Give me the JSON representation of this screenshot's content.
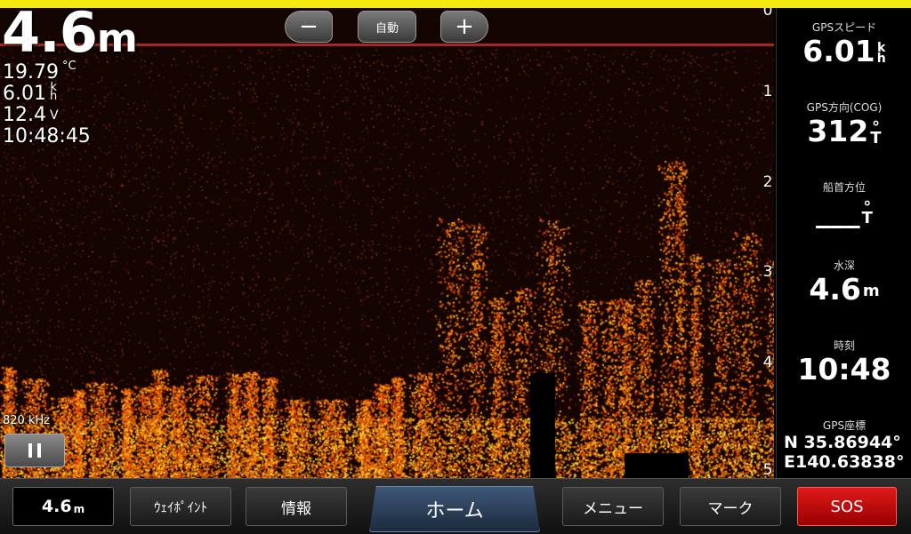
{
  "sonar": {
    "depth": "4.6",
    "depth_unit": "m",
    "water_temp": "19.79",
    "water_temp_unit": "°C",
    "speed": "6.01",
    "speed_unit_top": "k",
    "speed_unit_bottom": "h",
    "voltage": "12.4",
    "voltage_unit": "V",
    "time": "10:48:45",
    "frequency": "820 kHz",
    "zoom_minus": "−",
    "zoom_auto": "自動",
    "zoom_plus": "+",
    "depth_scale": [
      "0",
      "1",
      "2",
      "3",
      "4",
      "5"
    ]
  },
  "panel": {
    "gps_speed_label": "GPSスピード",
    "gps_speed_value": "6.01",
    "gps_speed_unit_top": "k",
    "gps_speed_unit_bottom": "h",
    "cog_label": "GPS方向(COG)",
    "cog_value": "312",
    "cog_unit_top": "°",
    "cog_unit_bottom": "T",
    "heading_label": "船首方位",
    "heading_value": "___",
    "heading_unit_top": "°",
    "heading_unit_bottom": "T",
    "depth_label": "水深",
    "depth_value": "4.6",
    "depth_unit": "m",
    "time_label": "時刻",
    "time_value": "10:48",
    "coord_label": "GPS座標",
    "lat": "N  35.86944°",
    "lon": "E140.63838°"
  },
  "bottom_bar": {
    "depth_value": "4.6",
    "depth_unit": "m",
    "waypoint": "ｳｪｲﾎﾟｲﾝﾄ",
    "info": "情報",
    "home": "ホーム",
    "menu": "メニュー",
    "mark": "マーク",
    "sos": "SOS"
  },
  "colors": {
    "sos": "#d00000",
    "home": "#2c4260",
    "top_bar": "#f4ea10",
    "sonar_return": "#ff7a10"
  }
}
